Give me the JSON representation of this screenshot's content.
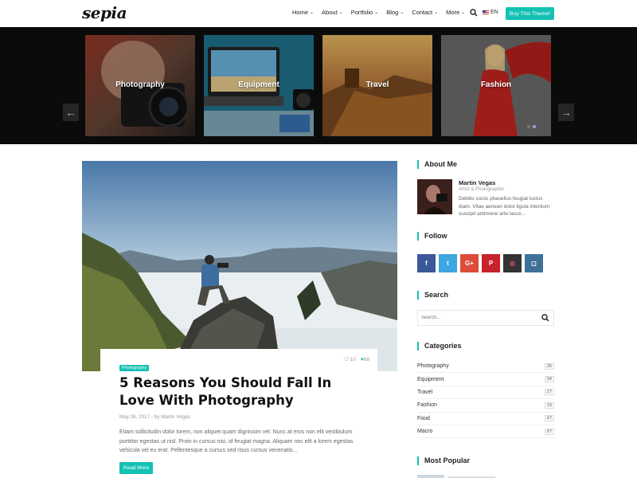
{
  "header": {
    "logo": "sepia",
    "nav": [
      {
        "label": "Home"
      },
      {
        "label": "About"
      },
      {
        "label": "Portfolio"
      },
      {
        "label": "Blog"
      },
      {
        "label": "Contact"
      },
      {
        "label": "More"
      }
    ],
    "language": "EN",
    "buy_button": "Buy This Theme!"
  },
  "slider": {
    "slides": [
      {
        "label": "Photography"
      },
      {
        "label": "Equipment"
      },
      {
        "label": "Travel"
      },
      {
        "label": "Fashion"
      }
    ],
    "prev_icon": "arrow-left-icon",
    "next_icon": "arrow-right-icon"
  },
  "post": {
    "comments": "10",
    "likes": "68",
    "category": "Photography",
    "title": "5 Reasons You Should Fall In Love With Photography",
    "meta": "May 26, 2017 - by Martin Vegas",
    "excerpt": "Etiam sollicitudin dolor lorem, non aliquet quam dignissim vel. Nunc at eros non elit vestibulum porttitor egestas ut nisl. Proin in cursus nisi, id feugiat magna. Aliquam nec elit a lorem egestas vehicula vel eu erat. Pellentesque a cursus sed risus cursus venenatis...",
    "read_more": "Read More"
  },
  "sidebar": {
    "about": {
      "title": "About Me",
      "name": "Martin Vegas",
      "role": "Artist & Photographer",
      "text": "Debitis sociis phasellus feugiat luctus diam. Vitae aenean dolor ligula interdum suscipit antimone arte lacus .."
    },
    "follow": {
      "title": "Follow",
      "networks": [
        {
          "icon": "facebook-icon",
          "glyph": "f",
          "color": "#3b5998"
        },
        {
          "icon": "twitter-icon",
          "glyph": "t",
          "color": "#3ea6e0"
        },
        {
          "icon": "google-plus-icon",
          "glyph": "G+",
          "color": "#dd4b39"
        },
        {
          "icon": "pinterest-icon",
          "glyph": "P",
          "color": "#c8232c"
        },
        {
          "icon": "dribbble-icon",
          "glyph": "◎",
          "color": "#333333"
        },
        {
          "icon": "instagram-icon",
          "glyph": "◻",
          "color": "#3f729b"
        }
      ]
    },
    "search": {
      "title": "Search",
      "placeholder": "Search..."
    },
    "categories": {
      "title": "Categories",
      "items": [
        {
          "name": "Photography",
          "count": "26"
        },
        {
          "name": "Equipment",
          "count": "54"
        },
        {
          "name": "Travel",
          "count": "17"
        },
        {
          "name": "Fashion",
          "count": "19"
        },
        {
          "name": "Food",
          "count": "67"
        },
        {
          "name": "Macro",
          "count": "67"
        }
      ]
    },
    "popular": {
      "title": "Most Popular"
    }
  },
  "colors": {
    "accent": "#14c1b4",
    "slider_bg": "#0b0b0b"
  }
}
